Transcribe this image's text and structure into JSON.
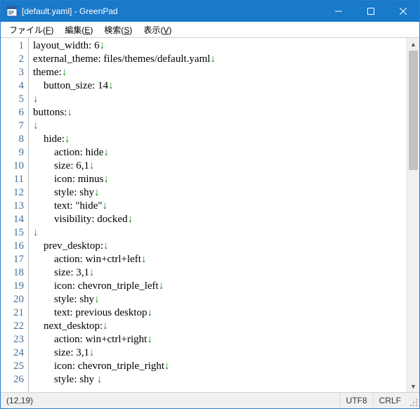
{
  "title": "[default.yaml] - GreenPad",
  "menu": {
    "file": {
      "label": "ファイル",
      "mnemonic": "F"
    },
    "edit": {
      "label": "編集",
      "mnemonic": "E"
    },
    "search": {
      "label": "検索",
      "mnemonic": "S"
    },
    "view": {
      "label": "表示",
      "mnemonic": "V"
    }
  },
  "colors": {
    "titlebar": "#1979ca",
    "eol": "#0a8a0a",
    "lineno": "#416f9b"
  },
  "editor": {
    "first_visible_line": 1,
    "visible_line_count": 26,
    "lines": [
      "layout_width: 6",
      "external_theme: files/themes/default.yaml",
      "theme:",
      "    button_size: 14",
      "",
      "buttons:",
      "",
      "    hide:",
      "        action: hide",
      "        size: 6,1",
      "        icon: minus",
      "        style: shy",
      "        text: \"hide\"",
      "        visibility: docked",
      "",
      "    prev_desktop:",
      "        action: win+ctrl+left",
      "        size: 3,1",
      "        icon: chevron_triple_left",
      "        style: shy",
      "        text: previous desktop",
      "    next_desktop:",
      "        action: win+ctrl+right",
      "        size: 3,1",
      "        icon: chevron_triple_right",
      "        style: shy "
    ],
    "eol_marker": "↓"
  },
  "status": {
    "cursor": "(12,19)",
    "encoding": "UTF8",
    "lineending": "CRLF"
  }
}
